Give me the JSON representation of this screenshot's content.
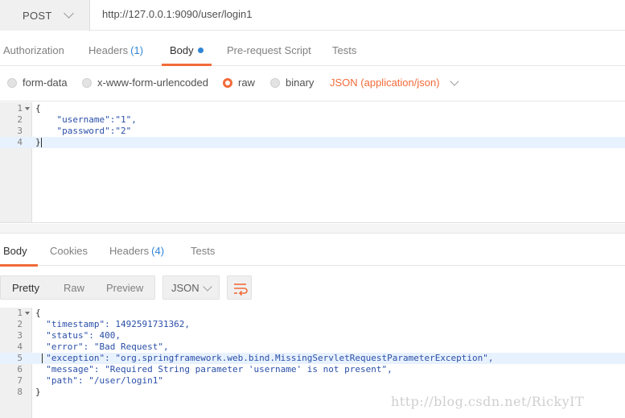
{
  "request": {
    "method": "POST",
    "url": "http://127.0.0.1:9090/user/login1"
  },
  "request_tabs": {
    "authorization": "Authorization",
    "headers": "Headers",
    "headers_count": "(1)",
    "body": "Body",
    "pre_request": "Pre-request Script",
    "tests": "Tests"
  },
  "body_types": {
    "form_data": "form-data",
    "urlencoded": "x-www-form-urlencoded",
    "raw": "raw",
    "binary": "binary",
    "content_type": "JSON (application/json)"
  },
  "request_body": {
    "line_numbers": [
      "1",
      "2",
      "3",
      "4"
    ],
    "lines": [
      "{",
      "    \"username\":\"1\",",
      "    \"password\":\"2\"",
      "}"
    ]
  },
  "response_tabs": {
    "body": "Body",
    "cookies": "Cookies",
    "headers": "Headers",
    "headers_count": "(4)",
    "tests": "Tests"
  },
  "response_toolbar": {
    "pretty": "Pretty",
    "raw": "Raw",
    "preview": "Preview",
    "format": "JSON"
  },
  "response_body": {
    "line_numbers": [
      "1",
      "2",
      "3",
      "4",
      "5",
      "6",
      "7",
      "8"
    ],
    "lines": [
      "{",
      "  \"timestamp\": 1492591731362,",
      "  \"status\": 400,",
      "  \"error\": \"Bad Request\",",
      "  \"exception\": \"org.springframework.web.bind.MissingServletRequestParameterException\",",
      "  \"message\": \"Required String parameter 'username' is not present\",",
      "  \"path\": \"/user/login1\"",
      "}"
    ]
  },
  "watermark": "http://blog.csdn.net/RickyIT",
  "colors": {
    "accent": "#f26b3a",
    "count_blue": "#2f86d6",
    "json_blue": "#2a4fa8"
  }
}
